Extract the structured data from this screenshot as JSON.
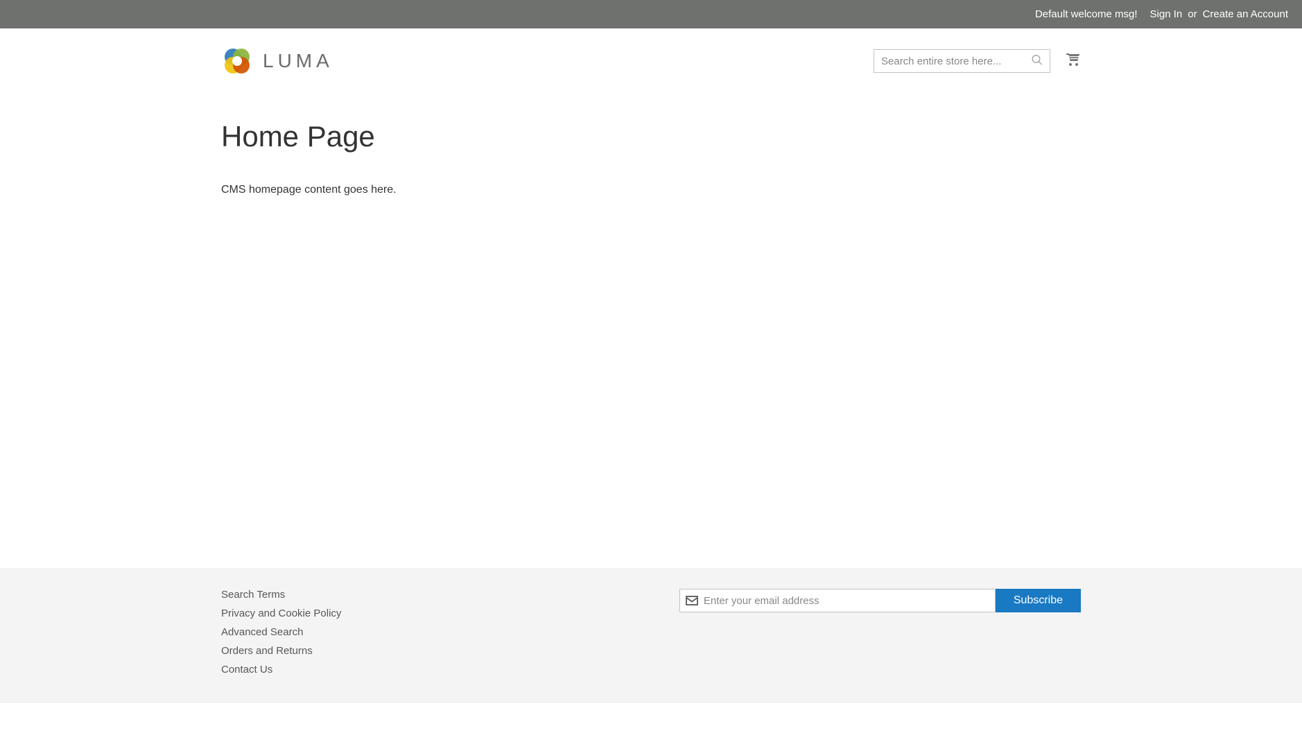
{
  "topbar": {
    "welcome": "Default welcome msg!",
    "sign_in": "Sign In",
    "or": "or",
    "create_account": "Create an Account"
  },
  "header": {
    "brand": "LUMA",
    "search_placeholder": "Search entire store here..."
  },
  "main": {
    "title": "Home Page",
    "content": "CMS homepage content goes here."
  },
  "footer": {
    "links": [
      "Search Terms",
      "Privacy and Cookie Policy",
      "Advanced Search",
      "Orders and Returns",
      "Contact Us"
    ],
    "newsletter_placeholder": "Enter your email address",
    "subscribe_label": "Subscribe"
  }
}
